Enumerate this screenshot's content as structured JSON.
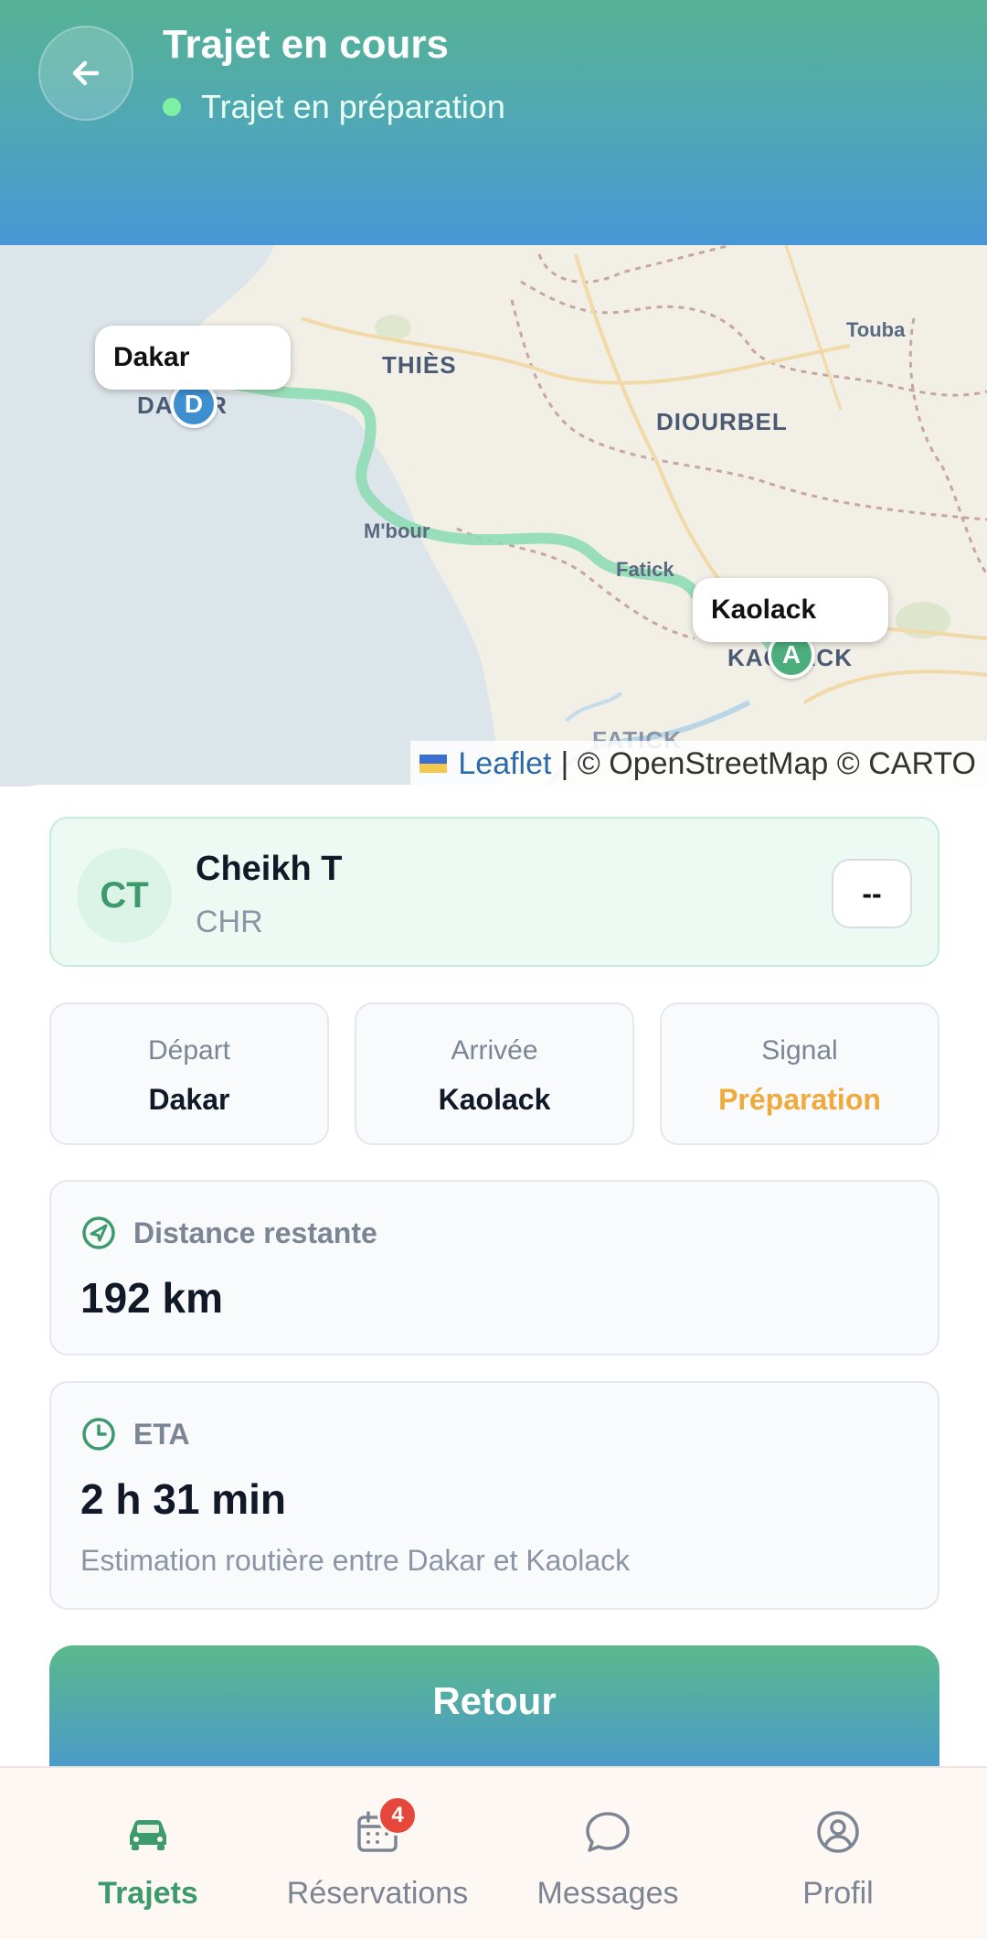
{
  "header": {
    "title": "Trajet en cours",
    "status": "Trajet en préparation"
  },
  "map": {
    "regions": [
      "THIÈS",
      "DIOURBEL",
      "FATICK"
    ],
    "places": [
      "Touba",
      "M'bour",
      "Fatick",
      "DAKAR",
      "KAOLACK"
    ],
    "popup_start": "Dakar",
    "popup_end": "Kaolack",
    "pin_start": "D",
    "pin_end": "A",
    "attribution_link": "Leaflet",
    "attribution_rest": "| © OpenStreetMap © CARTO"
  },
  "driver": {
    "initials": "CT",
    "name": "Cheikh T",
    "vehicle": "CHR",
    "rating": "--"
  },
  "stats": [
    {
      "label": "Départ",
      "value": "Dakar"
    },
    {
      "label": "Arrivée",
      "value": "Kaolack"
    },
    {
      "label": "Signal",
      "value": "Préparation"
    }
  ],
  "distance": {
    "label": "Distance restante",
    "value": "192 km"
  },
  "eta": {
    "label": "ETA",
    "value": "2 h 31 min",
    "note": "Estimation routière entre Dakar et Kaolack"
  },
  "cta_label": "Retour",
  "tabs": [
    {
      "label": "Trajets"
    },
    {
      "label": "Réservations",
      "badge": "4"
    },
    {
      "label": "Messages"
    },
    {
      "label": "Profil"
    }
  ],
  "colors": {
    "accent": "#3c9a6c",
    "signal_warning": "#f0a93b",
    "badge": "#e5483b"
  }
}
